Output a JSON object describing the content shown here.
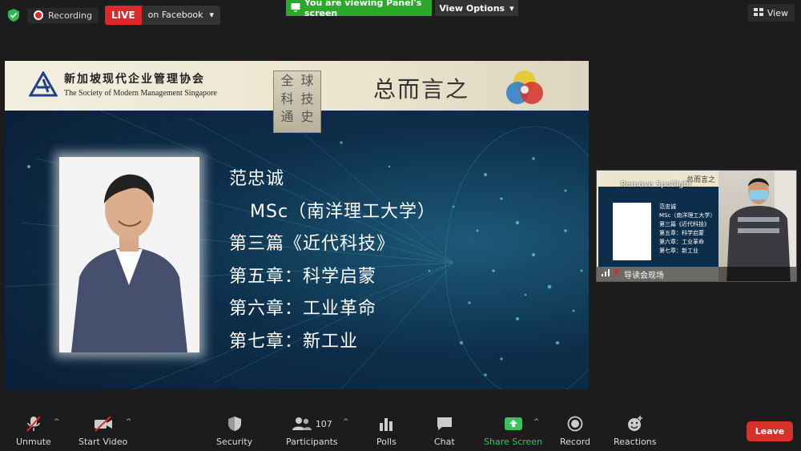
{
  "topbar": {
    "recording_label": "Recording",
    "live_label": "LIVE",
    "live_platform": "on Facebook",
    "viewing_banner": "You are viewing Panel's screen",
    "view_options_label": "View Options",
    "view_label": "View"
  },
  "slide": {
    "org_cn": "新加坡现代企业管理协会",
    "org_en": "The Society of Modern Management Singapore",
    "book_chars": [
      "全",
      "球",
      "科",
      "技",
      "通",
      "史"
    ],
    "title": "总而言之",
    "lines": [
      "范忠诚",
      "MSc（南洋理工大学）",
      "第三篇《近代科技》",
      "第五章：科学启蒙",
      "第六章：工业革命",
      "第七章：新工业"
    ]
  },
  "thumbnail": {
    "remove_spotlight": "Remove Spotlight",
    "slide_title": "总而言之",
    "participant_name": "导读会现场",
    "lines": [
      "范忠诚",
      "MSc（南洋理工大学）",
      "第三篇《近代科技》",
      "第五章：科学启蒙",
      "第六章：工业革命",
      "第七章：新工业"
    ]
  },
  "toolbar": {
    "unmute": "Unmute",
    "start_video": "Start Video",
    "security": "Security",
    "participants": "Participants",
    "participants_count": "107",
    "polls": "Polls",
    "chat": "Chat",
    "share_screen": "Share Screen",
    "record": "Record",
    "reactions": "Reactions",
    "leave": "Leave"
  },
  "colors": {
    "live_red": "#e02828",
    "share_green": "#3cc25a",
    "leave_red": "#d5322b",
    "banner_green": "#2aa82a"
  }
}
